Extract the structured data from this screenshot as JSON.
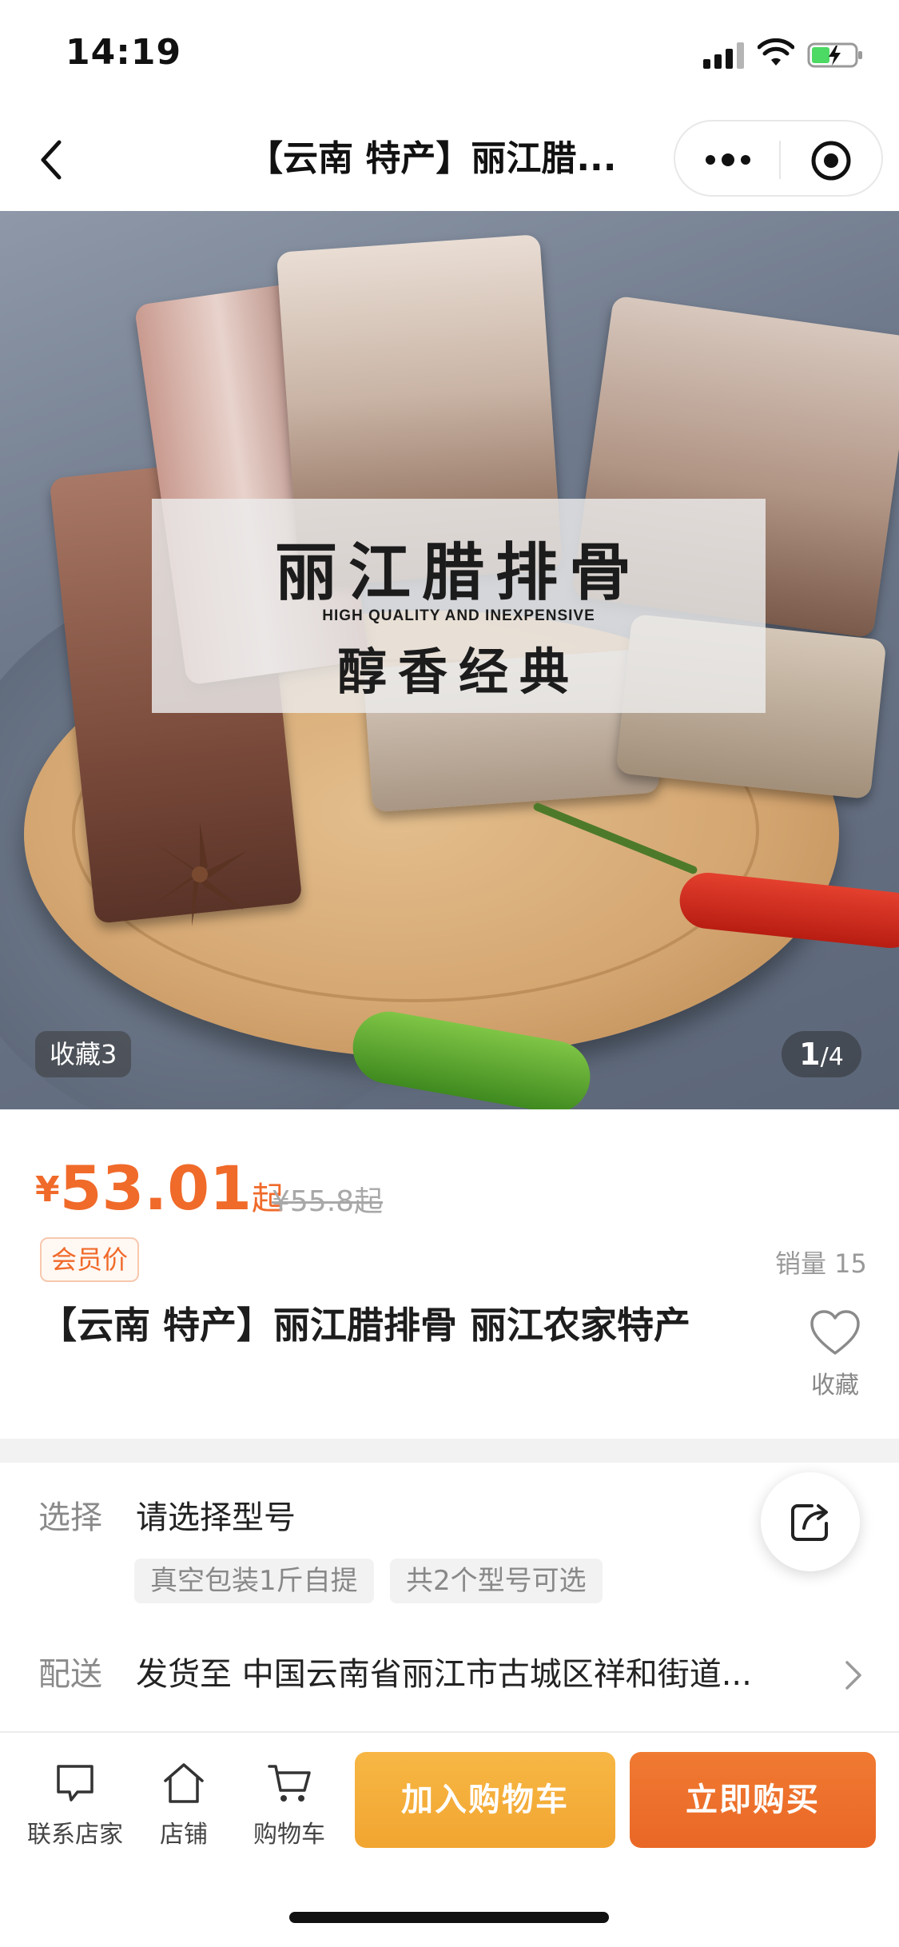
{
  "status_bar": {
    "time": "14:19"
  },
  "nav": {
    "title": "【云南 特产】丽江腊..."
  },
  "hero": {
    "banner_title": "丽江腊排骨",
    "banner_subtitle": "HIGH QUALITY AND INEXPENSIVE",
    "banner_tagline": "醇香经典",
    "favorites_count": "收藏3",
    "pager_current": "1",
    "pager_total": "/4"
  },
  "product": {
    "currency": "¥",
    "price": "53.01",
    "price_suffix": "起",
    "original_price": "¥55.8起",
    "member_badge": "会员价",
    "sales": "销量 15",
    "title": "【云南 特产】丽江腊排骨 丽江农家特产",
    "collect_label": "收藏"
  },
  "options": {
    "select_label": "选择",
    "select_value": "请选择型号",
    "chips": [
      "真空包装1斤自提",
      "共2个型号可选"
    ],
    "ship_label": "配送",
    "ship_value": "发货至 中国云南省丽江市古城区祥和街道..."
  },
  "bottom_bar": {
    "contact_label": "联系店家",
    "store_label": "店铺",
    "cart_label": "购物车",
    "add_to_cart": "加入购物车",
    "buy_now": "立即购买"
  },
  "colors": {
    "accent_orange": "#f06a2a",
    "cart_button": "#f2a531",
    "buy_button": "#ea6726"
  }
}
